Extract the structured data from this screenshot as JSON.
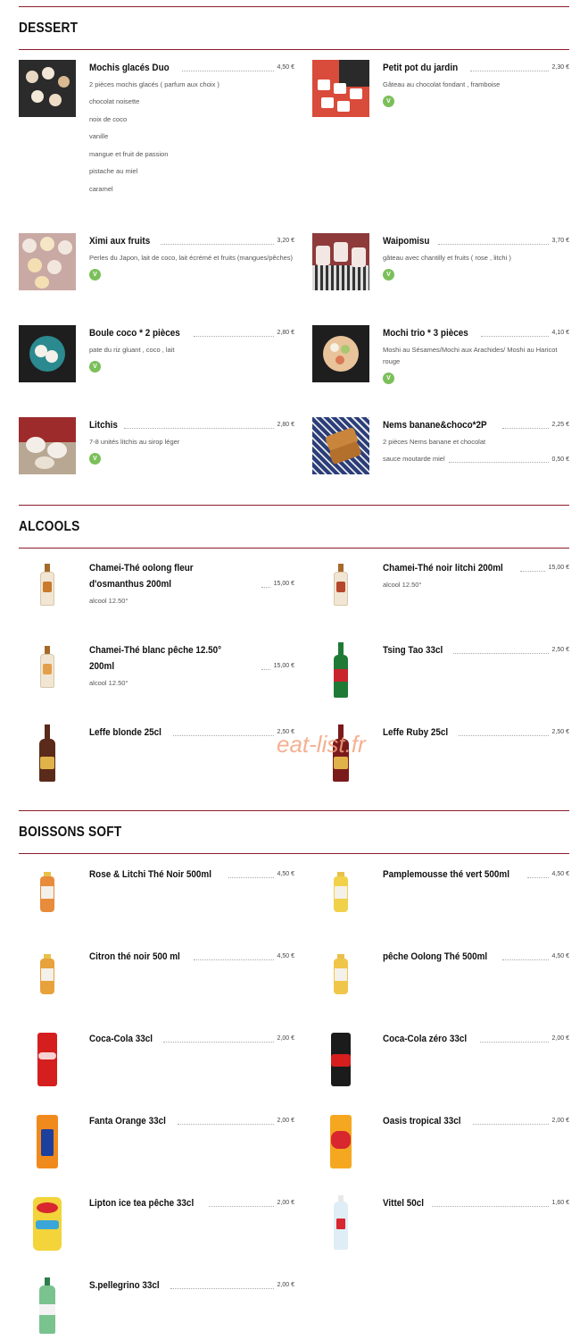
{
  "watermark": "eat-list.fr",
  "sections": {
    "dessert": {
      "title": "DESSERT",
      "items": [
        {
          "name": "Mochis glacés Duo",
          "price": "4,50 €",
          "desc": "2 pièces mochis glacés ( parfum aux choix )",
          "options": [
            "chocolat noisette",
            "noix de coco",
            "vanille",
            "mangue et fruit de passion",
            "pistache au miel",
            "caramel"
          ]
        },
        {
          "name": "Petit pot du jardin",
          "price": "2,30 €",
          "desc": "Gâteau au chocolat fondant , framboise",
          "veg": "V"
        },
        {
          "name": "Ximi aux fruits",
          "price": "3,20 €",
          "desc": "Perles du Japon, lait de coco, lait écrémé et fruits (mangues/pêches)",
          "veg": "V"
        },
        {
          "name": "Waipomisu",
          "price": "3,70 €",
          "desc": "gâteau avec chantilly et fruits ( rose , litchi )",
          "veg": "V"
        },
        {
          "name": "Boule coco * 2 pièces",
          "price": "2,80 €",
          "desc": "pate du riz gluant , coco , lait",
          "veg": "V"
        },
        {
          "name": "Mochi trio * 3 pièces",
          "price": "4,10 €",
          "desc": "Moshi au Sésames/Mochi aux Arachides/ Moshi au Haricot rouge",
          "veg": "V"
        },
        {
          "name": "Litchis",
          "price": "2,80 €",
          "desc": "7-8 unités litchis au sirop léger",
          "veg": "V"
        },
        {
          "name": "Nems banane&choco*2P",
          "price": "2,25 €",
          "desc": "2 pièces Nems banane et chocolat",
          "extra": {
            "label": "sauce moutarde miel",
            "price": "0,50 €"
          }
        }
      ]
    },
    "alcools": {
      "title": "ALCOOLS",
      "items": [
        {
          "name": "Chamei-Thé oolong fleur d'osmanthus 200ml",
          "price": "15,00 €",
          "desc": "alcool 12.50°"
        },
        {
          "name": "Chamei-Thé noir litchi 200ml",
          "price": "15,00 €",
          "desc": "alcool 12.50°"
        },
        {
          "name": "Chamei-Thé blanc pêche 12.50° 200ml",
          "price": "15,00 €",
          "desc": "alcool 12.50°"
        },
        {
          "name": "Tsing Tao 33cl",
          "price": "2,50 €"
        },
        {
          "name": "Leffe blonde 25cl",
          "price": "2,50 €"
        },
        {
          "name": "Leffe Ruby 25cl",
          "price": "2,50 €"
        }
      ]
    },
    "soft": {
      "title": "BOISSONS SOFT",
      "items": [
        {
          "name": "Rose & Litchi Thé Noir 500ml",
          "price": "4,50 €"
        },
        {
          "name": "Pamplemousse thé vert 500ml",
          "price": "4,50 €"
        },
        {
          "name": "Citron thé noir 500 ml",
          "price": "4,50 €"
        },
        {
          "name": "pêche Oolong Thé 500ml",
          "price": "4,50 €"
        },
        {
          "name": "Coca-Cola 33cl",
          "price": "2,00 €"
        },
        {
          "name": "Coca-Cola zéro 33cl",
          "price": "2,00 €"
        },
        {
          "name": "Fanta Orange 33cl",
          "price": "2,00 €"
        },
        {
          "name": "Oasis tropical 33cl",
          "price": "2,00 €"
        },
        {
          "name": "Lipton ice tea pêche 33cl",
          "price": "2,00 €"
        },
        {
          "name": "Vittel 50cl",
          "price": "1,60 €"
        },
        {
          "name": "S.pellegrino 33cl",
          "price": "2,00 €"
        }
      ]
    }
  }
}
